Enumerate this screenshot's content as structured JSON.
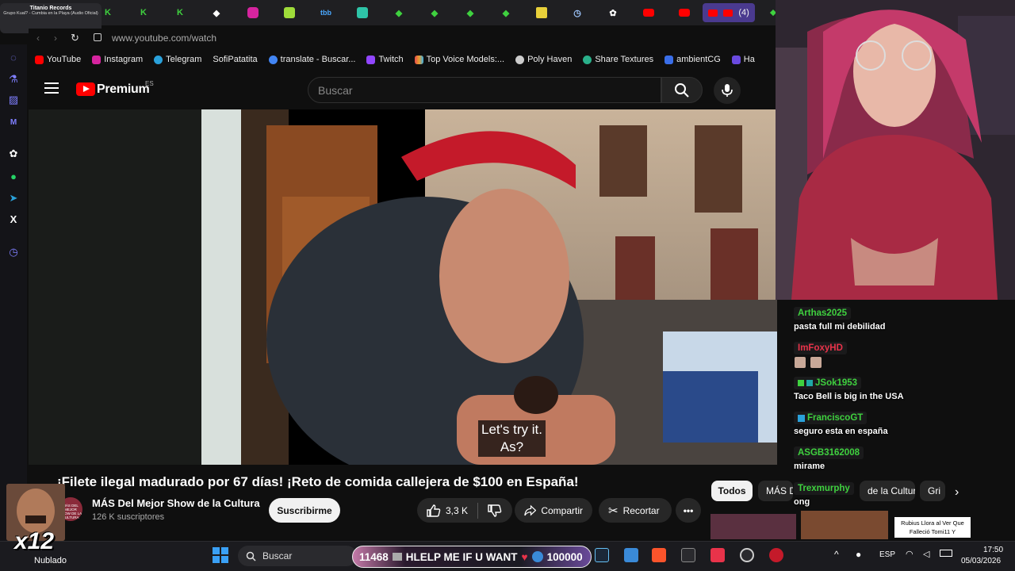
{
  "browser": {
    "now_playing": {
      "artist": "Titanio Records",
      "title": "Grupo Kual? - Cumbia en la Playa (Audio Oficial)"
    },
    "active_tab_badge": "(4)",
    "url": "www.youtube.com/watch",
    "bookmarks": [
      {
        "label": "YouTube",
        "color": "#ff0000"
      },
      {
        "label": "Instagram",
        "color": "#d6249f"
      },
      {
        "label": "Telegram",
        "color": "#2aa1da"
      },
      {
        "label": "SofiPatatita",
        "color": "#f0c040"
      },
      {
        "label": "translate - Buscar...",
        "color": "#4285f4"
      },
      {
        "label": "Twitch",
        "color": "#9146ff"
      },
      {
        "label": "Top Voice Models:...",
        "color": "#e8a030"
      },
      {
        "label": "Poly Haven",
        "color": "#cccccc"
      },
      {
        "label": "Share Textures",
        "color": "#2ab08a"
      },
      {
        "label": "ambientCG",
        "color": "#3a6ee8"
      },
      {
        "label": "Ha",
        "color": "#6a4adf"
      }
    ]
  },
  "youtube": {
    "brand": "Premium",
    "region": "ES",
    "search_placeholder": "Buscar",
    "caption_line1": "Let's try it.",
    "caption_line2": "As?",
    "video_title": "¡Filete ilegal madurado por 67 días! ¡Reto de comida callejera de $100 en España!",
    "channel": {
      "name": "MÁS Del Mejor Show de la Cultura",
      "subscribers": "126 K suscriptores",
      "avatar_text": "MÁS DEL MEJOR SHOW DE LA CULTURA"
    },
    "subscribe_label": "Suscribirme",
    "likes": "3,3 K",
    "share_label": "Compartir",
    "clip_label": "Recortar",
    "chips": [
      "Todos",
      "MÁS De",
      "de la Cultura",
      "Gri"
    ]
  },
  "chat": [
    {
      "user": "Arthas2025",
      "color": "#3fd13f",
      "message": "pasta full mi debilidad"
    },
    {
      "user": "ImFoxyHD",
      "color": "#e8334a",
      "message": ""
    },
    {
      "user": "JSok1953",
      "color": "#3fd13f",
      "message": "Taco Bell is big in the USA"
    },
    {
      "user": "FranciscoGT",
      "color": "#3fd13f",
      "message": "seguro esta en españa"
    },
    {
      "user": "ASGB3162008",
      "color": "#3fd13f",
      "message": "mirame"
    },
    {
      "user": "Trexmurphy",
      "color": "#3fd13f",
      "message": "ong"
    }
  ],
  "taskbar": {
    "weather_badge": "x12",
    "weather_label": "Nublado",
    "search_label": "Buscar",
    "banner_left": "11468",
    "banner_text": "HLELP ME IF U WANT",
    "banner_right": "100000",
    "lang": "ESP",
    "time": "17:50",
    "date": "05/03/2026",
    "thumbnail_caption": "Rubius Llora al Ver Que Falleció Tomi11 Y"
  }
}
